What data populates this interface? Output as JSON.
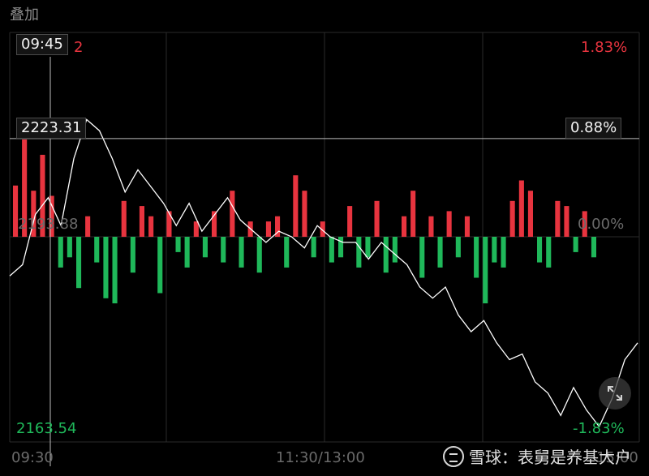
{
  "header": {
    "overlay_label": "叠加"
  },
  "cursor": {
    "time": "09:45",
    "price": "2223.31",
    "pct": "0.88%",
    "count": "2"
  },
  "labels": {
    "top_right_pct": "1.83%",
    "mid_left_price": "2193.88",
    "mid_right_pct": "0.00%",
    "bottom_left_price": "2163.54",
    "bottom_right_pct": "-1.83%",
    "time_start": "09:30",
    "time_mid": "11:30/13:00",
    "time_end": "15:00"
  },
  "watermark": {
    "text": "雪球：表舅是养基大户"
  },
  "colors": {
    "up": "#e8343f",
    "down": "#1fb85a",
    "line": "#ffffff",
    "grid": "#2a2a2a"
  },
  "chart_data": {
    "type": "line",
    "y_axis_left": {
      "min": 2163.54,
      "base": 2193.88,
      "max": 2223.31
    },
    "y_axis_right_pct": {
      "min": -1.83,
      "base": 0.0,
      "max": 1.83
    },
    "x_labels": [
      "09:30",
      "11:30/13:00",
      "15:00"
    ],
    "series": [
      {
        "kind": "line",
        "values_pct": [
          -0.35,
          -0.25,
          0.2,
          0.35,
          0.1,
          0.7,
          1.05,
          0.95,
          0.7,
          0.4,
          0.6,
          0.45,
          0.3,
          0.1,
          0.3,
          0.05,
          0.2,
          0.35,
          0.15,
          0.05,
          -0.05,
          0.05,
          0.0,
          -0.1,
          0.1,
          0.0,
          -0.05,
          -0.05,
          -0.2,
          -0.05,
          -0.15,
          -0.25,
          -0.45,
          -0.55,
          -0.45,
          -0.7,
          -0.85,
          -0.75,
          -0.95,
          -1.1,
          -1.05,
          -1.3,
          -1.4,
          -1.6,
          -1.35,
          -1.55,
          -1.7,
          -1.45,
          -1.1,
          -0.95
        ]
      },
      {
        "kind": "bar",
        "name_up": "up",
        "name_down": "down",
        "values": [
          1.0,
          1.9,
          0.9,
          1.6,
          0.8,
          -0.6,
          -0.4,
          -1.0,
          0.4,
          -0.5,
          -1.2,
          -1.3,
          0.7,
          -0.7,
          0.6,
          0.4,
          -1.1,
          0.5,
          -0.3,
          -0.6,
          0.3,
          -0.4,
          0.5,
          -0.5,
          0.9,
          -0.6,
          0.3,
          -0.7,
          0.3,
          0.4,
          -0.6,
          1.2,
          0.9,
          -0.4,
          0.3,
          -0.5,
          -0.4,
          0.6,
          -0.6,
          -0.4,
          0.7,
          -0.7,
          -0.5,
          0.4,
          0.9,
          -0.8,
          0.4,
          -0.6,
          0.5,
          -0.4,
          0.4,
          -0.8,
          -1.3,
          -0.5,
          -0.6,
          0.7,
          1.1,
          0.9,
          -0.5,
          -0.6,
          0.7,
          0.6,
          -0.3,
          0.5,
          -0.4
        ]
      }
    ]
  }
}
